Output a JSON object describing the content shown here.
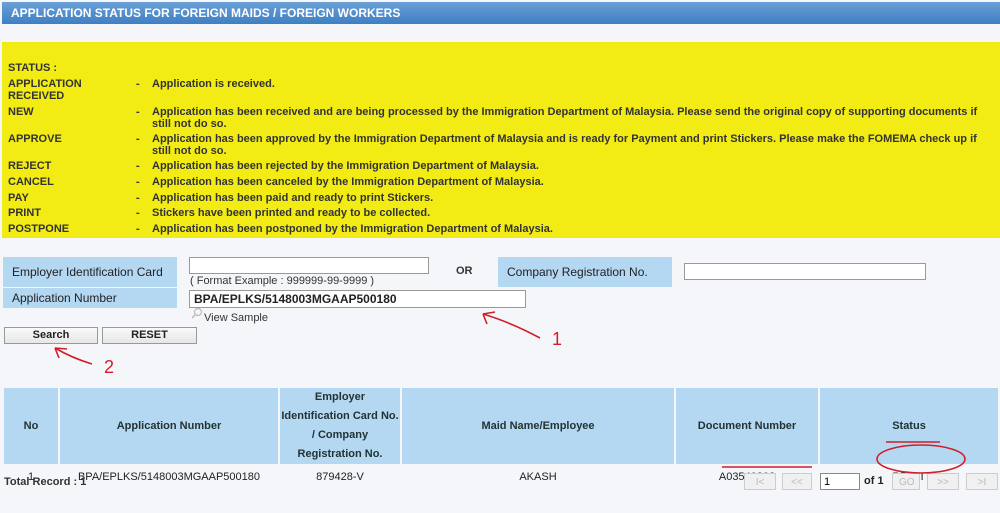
{
  "header": {
    "title": "APPLICATION STATUS FOR FOREIGN MAIDS / FOREIGN WORKERS"
  },
  "legend": {
    "heading": "STATUS :",
    "items": [
      {
        "key": "APPLICATION RECEIVED",
        "desc": "Application is received."
      },
      {
        "key": "NEW",
        "desc": "Application has been received and are being processed by the Immigration Department of Malaysia. Please send the original copy of supporting documents if still not do so."
      },
      {
        "key": "APPROVE",
        "desc": "Application has been approved by the Immigration Department of Malaysia and is ready for Payment and print Stickers. Please make the FOMEMA check up if still not do so."
      },
      {
        "key": "REJECT",
        "desc": "Application has been rejected by the Immigration Department of Malaysia."
      },
      {
        "key": "CANCEL",
        "desc": "Application has been canceled by the Immigration Department of Malaysia."
      },
      {
        "key": "PAY",
        "desc": "Application has been paid and ready to print Stickers."
      },
      {
        "key": "PRINT",
        "desc": "Stickers have been printed and ready to be collected."
      },
      {
        "key": "POSTPONE",
        "desc": "Application has been postponed by the Immigration Department of Malaysia."
      }
    ]
  },
  "form": {
    "employer_ic_label": "Employer Identification Card No.",
    "employer_ic_value": "",
    "employer_ic_hint": "( Format Example : 999999-99-9999 )",
    "or_label": "OR",
    "company_reg_label": "Company Registration No.",
    "company_reg_value": "",
    "app_number_label": "Application Number",
    "app_number_value": "BPA/EPLKS/5148003MGAAP500180",
    "view_sample": "View Sample",
    "search_label": "Search",
    "reset_label": "RESET"
  },
  "table": {
    "headers": [
      "No",
      "Application Number",
      "Employer Identification Card No. / Company Registration No.",
      "Maid Name/Employee",
      "Document Number",
      "Status"
    ],
    "rows": [
      {
        "no": "1",
        "app_number": "BPA/EPLKS/5148003MGAAP500180",
        "employer_id": "879428-V",
        "name": "AKASH",
        "doc_number": "A03540302",
        "status": "PRINT"
      }
    ],
    "total": "Total Record : 1"
  },
  "pagination": {
    "first": "I<",
    "prev": "<<",
    "page": "1",
    "of": "of 1",
    "go": "GO",
    "next": ">>",
    "last": ">I"
  },
  "annotations": {
    "arrow1": "1",
    "arrow2": "2",
    "color": "#d01f2a"
  }
}
